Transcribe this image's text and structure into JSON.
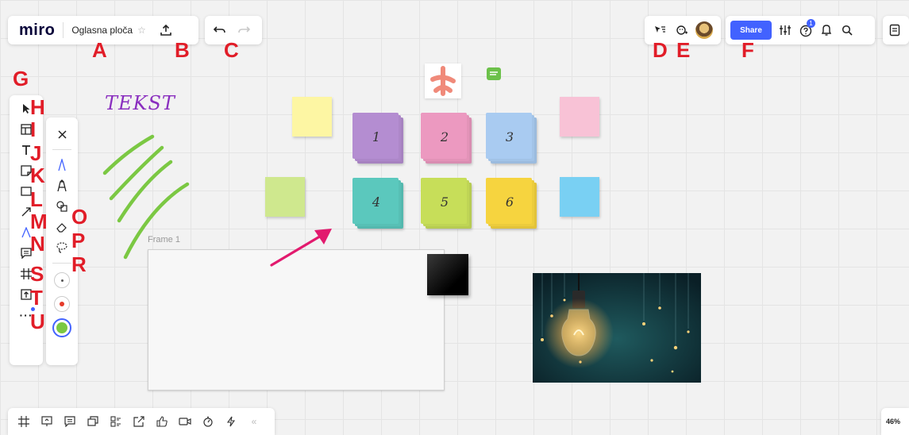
{
  "app": {
    "logo": "miro",
    "board_name": "Oglasna ploča",
    "star_glyph": "☆"
  },
  "toolbar_right": {
    "share_label": "Share",
    "help_badge": "1"
  },
  "frame": {
    "label": "Frame 1"
  },
  "canvas_text": {
    "tekst": "TEKST"
  },
  "zoom": {
    "level": "46%"
  },
  "stickies": [
    {
      "label": "1",
      "color": "#b48dd1"
    },
    {
      "label": "2",
      "color": "#ec99c0"
    },
    {
      "label": "3",
      "color": "#a9cbf1"
    },
    {
      "label": "4",
      "color": "#5bc8bd"
    },
    {
      "label": "5",
      "color": "#c7de59"
    },
    {
      "label": "6",
      "color": "#f6d43f"
    }
  ],
  "annotations": {
    "A": "A",
    "B": "B",
    "C": "C",
    "D": "D",
    "E": "E",
    "F": "F",
    "G": "G",
    "H": "H",
    "I": "I",
    "J": "J",
    "K": "K",
    "L": "L",
    "M": "M",
    "N": "N",
    "O": "O",
    "P": "P",
    "R": "R",
    "S": "S",
    "T": "T",
    "U": "U"
  },
  "colors": {
    "accent": "#4262ff",
    "annotation_red": "#e11d28",
    "arrow_pink": "#e21a6e",
    "stroke_green": "#7bc843"
  }
}
